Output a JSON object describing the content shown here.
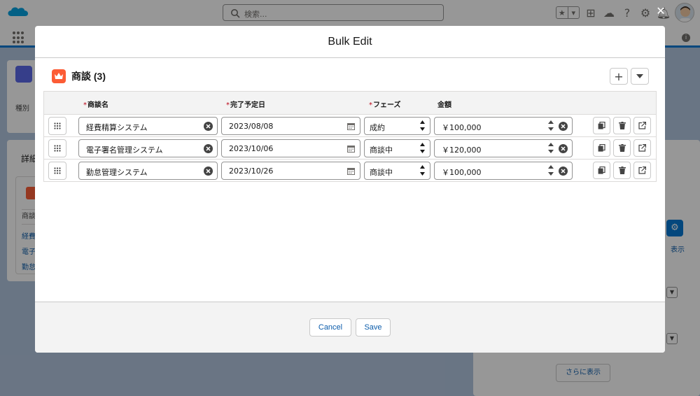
{
  "app": {
    "search_placeholder": "検索...",
    "background_field_label": "種別",
    "background_details_tab": "詳細",
    "background_table_col": "商談",
    "background_records": [
      "経費",
      "電子",
      "勤怠"
    ],
    "background_show_more": "さらに表示",
    "background_show_link": "表示"
  },
  "modal": {
    "title": "Bulk Edit",
    "close_icon": "close-x-icon",
    "related_list_title": "商談 (3)",
    "add_label": "+",
    "columns": {
      "name": "商談名",
      "close_date": "完了予定日",
      "stage": "フェーズ",
      "amount": "金額"
    },
    "rows": [
      {
        "name": "経費精算システム",
        "close_date": "2023/08/08",
        "stage": "成約",
        "amount": "￥100,000"
      },
      {
        "name": "電子署名管理システム",
        "close_date": "2023/10/06",
        "stage": "商談中",
        "amount": "￥120,000"
      },
      {
        "name": "勤怠管理システム",
        "close_date": "2023/10/26",
        "stage": "商談中",
        "amount": "￥100,000"
      }
    ],
    "cancel_label": "Cancel",
    "save_label": "Save"
  },
  "colors": {
    "brand_blue": "#0176d3",
    "opportunity_orange": "#fc5c35",
    "required_red": "#ba0517",
    "link_blue": "#0b5cab"
  }
}
